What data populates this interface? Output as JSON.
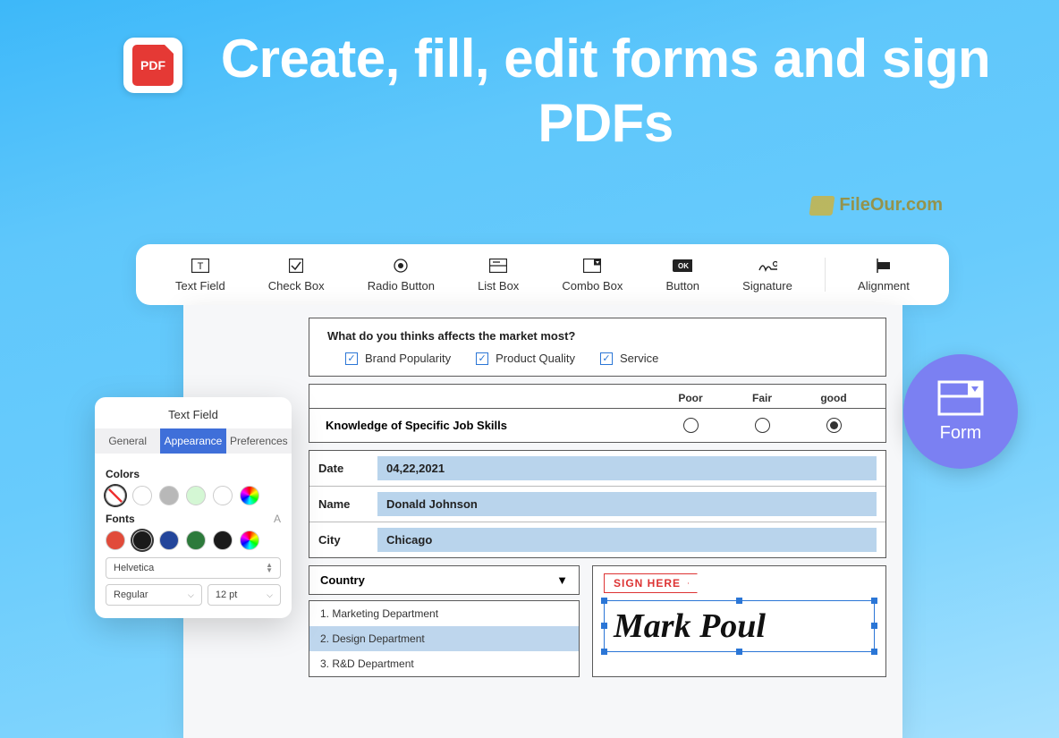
{
  "app_icon_label": "PDF",
  "headline": "Create, fill, edit forms and sign PDFs",
  "watermark": "FileOur.com",
  "toolbar": {
    "text_field": "Text Field",
    "check_box": "Check Box",
    "radio_button": "Radio Button",
    "list_box": "List Box",
    "combo_box": "Combo Box",
    "button": "Button",
    "signature": "Signature",
    "alignment": "Alignment"
  },
  "form": {
    "question": "What do you thinks affects the market most?",
    "options": [
      "Brand Popularity",
      "Product Quality",
      "Service"
    ],
    "rating_headers": [
      "Poor",
      "Fair",
      "good"
    ],
    "rating_label": "Knowledge of Specific Job Skills",
    "fields": {
      "date_label": "Date",
      "date_value": "04,22,2021",
      "name_label": "Name",
      "name_value": "Donald Johnson",
      "city_label": "City",
      "city_value": "Chicago"
    },
    "country_label": "Country",
    "departments": [
      "1. Marketing Department",
      "2. Design Department",
      "3. R&D Department"
    ],
    "sign_here": "SIGN HERE",
    "signature_text": "Mark Poul"
  },
  "badge_label": "Form",
  "panel": {
    "title": "Text Field",
    "tabs": [
      "General",
      "Appearance",
      "Preferences"
    ],
    "colors_label": "Colors",
    "fonts_label": "Fonts",
    "font_family": "Helvetica",
    "font_weight": "Regular",
    "font_size": "12 pt"
  },
  "colors": {
    "panel_colors": [
      "none",
      "#ffffff",
      "#b8b8b8",
      "#d4f7d4",
      "#ffffff",
      "rainbow"
    ],
    "font_colors": [
      "#e14b3a",
      "#1a1a1a",
      "#23459a",
      "#2d7a3b",
      "#1a1a1a",
      "rainbow"
    ]
  }
}
